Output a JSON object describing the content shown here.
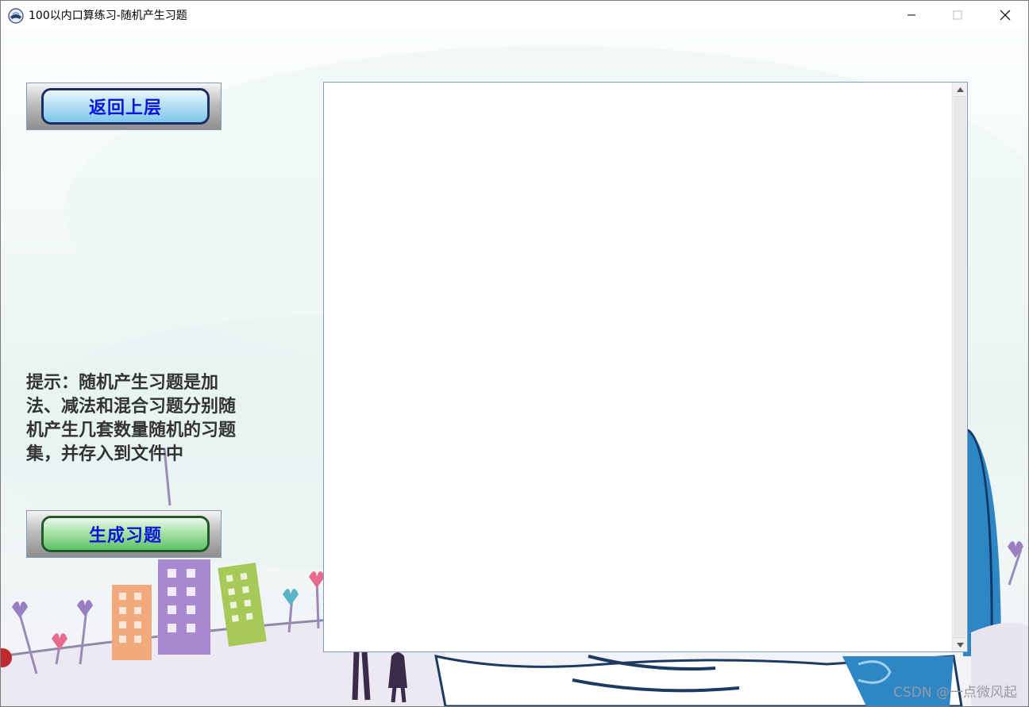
{
  "window": {
    "title": "100以内口算练习-随机产生习题",
    "minimize_icon": "minimize-icon",
    "maximize_icon": "maximize-icon",
    "close_icon": "close-icon"
  },
  "buttons": {
    "back_label": "返回上层",
    "generate_label": "生成习题"
  },
  "tip_text": "提示：随机产生习题是加\n法、减法和混合习题分别随\n机产生几套数量随机的习题\n集，并存入到文件中",
  "output": {
    "value": ""
  },
  "watermark": "CSDN @一点微风起",
  "colors": {
    "button_text": "#0a14d8",
    "back_button_face": "#9fd6f0",
    "generate_button_face": "#8fd98f",
    "tip_text": "#333333"
  }
}
